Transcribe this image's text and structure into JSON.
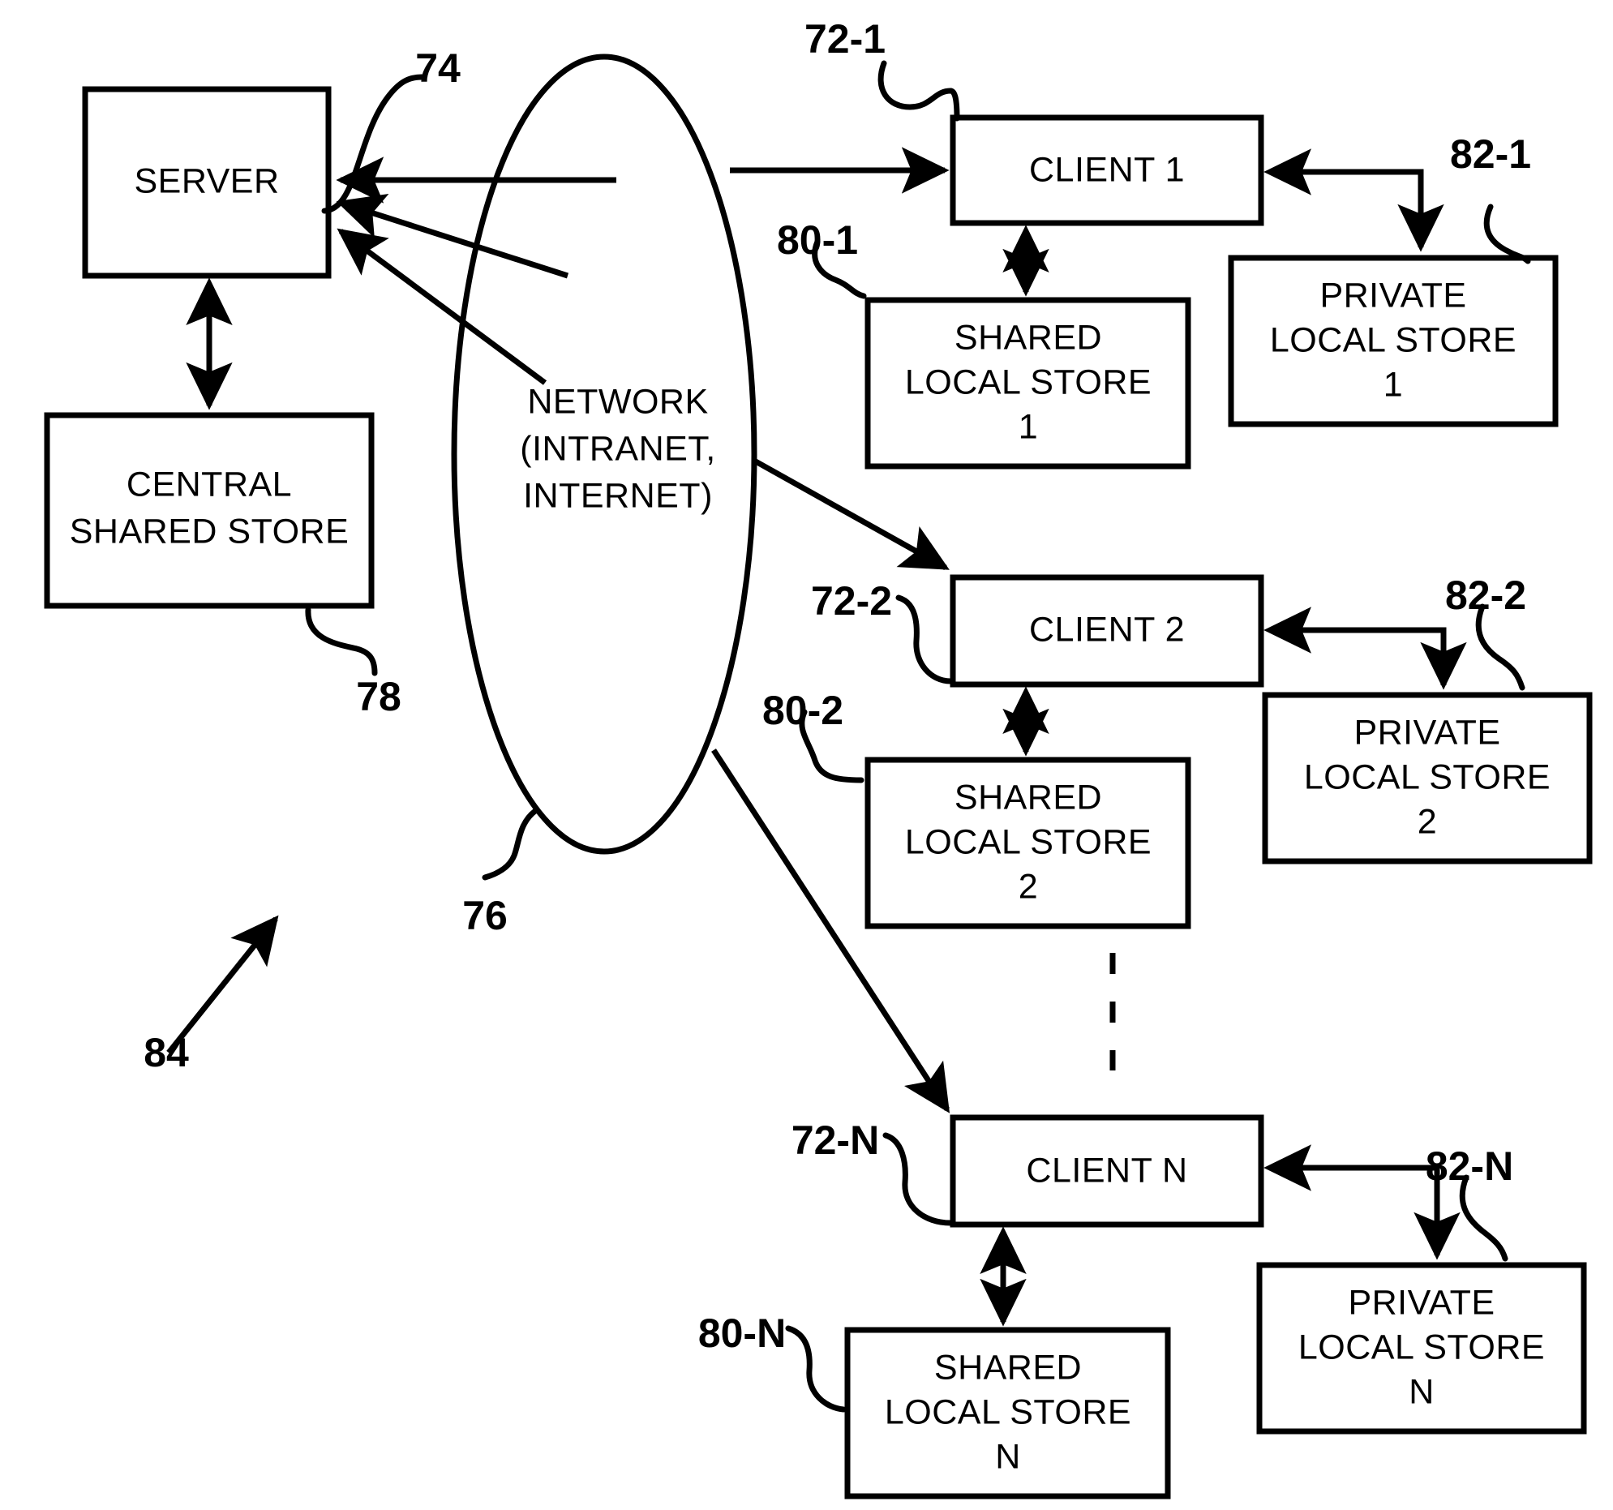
{
  "figure": {
    "type": "patent-block-diagram",
    "overall_ref": "84",
    "background_color": "#ffffff",
    "line_color": "#000000"
  },
  "nodes": {
    "server": {
      "label": "SERVER",
      "ref": "74"
    },
    "central_shared_store": {
      "line1": "CENTRAL",
      "line2": "SHARED STORE",
      "ref": "78"
    },
    "network": {
      "line1": "NETWORK",
      "line2": "(INTRANET,",
      "line3": "INTERNET)",
      "ref": "76"
    },
    "client1": {
      "label": "CLIENT 1",
      "ref": "72-1"
    },
    "client2": {
      "label": "CLIENT 2",
      "ref": "72-2"
    },
    "clientN": {
      "label": "CLIENT N",
      "ref": "72-N"
    },
    "shared_local_store_1": {
      "line1": "SHARED",
      "line2": "LOCAL STORE",
      "line3": "1",
      "ref": "80-1"
    },
    "shared_local_store_2": {
      "line1": "SHARED",
      "line2": "LOCAL STORE",
      "line3": "2",
      "ref": "80-2"
    },
    "shared_local_store_N": {
      "line1": "SHARED",
      "line2": "LOCAL STORE",
      "line3": "N",
      "ref": "80-N"
    },
    "private_local_store_1": {
      "line1": "PRIVATE",
      "line2": "LOCAL STORE",
      "line3": "1",
      "ref": "82-1"
    },
    "private_local_store_2": {
      "line1": "PRIVATE",
      "line2": "LOCAL STORE",
      "line3": "2",
      "ref": "82-2"
    },
    "private_local_store_N": {
      "line1": "PRIVATE",
      "line2": "LOCAL STORE",
      "line3": "N",
      "ref": "82-N"
    }
  },
  "refs": {
    "r74": "74",
    "r76": "76",
    "r78": "78",
    "r84": "84",
    "r72_1": "72-1",
    "r72_2": "72-2",
    "r72_N": "72-N",
    "r80_1": "80-1",
    "r80_2": "80-2",
    "r80_N": "80-N",
    "r82_1": "82-1",
    "r82_2": "82-2",
    "r82_N": "82-N"
  }
}
